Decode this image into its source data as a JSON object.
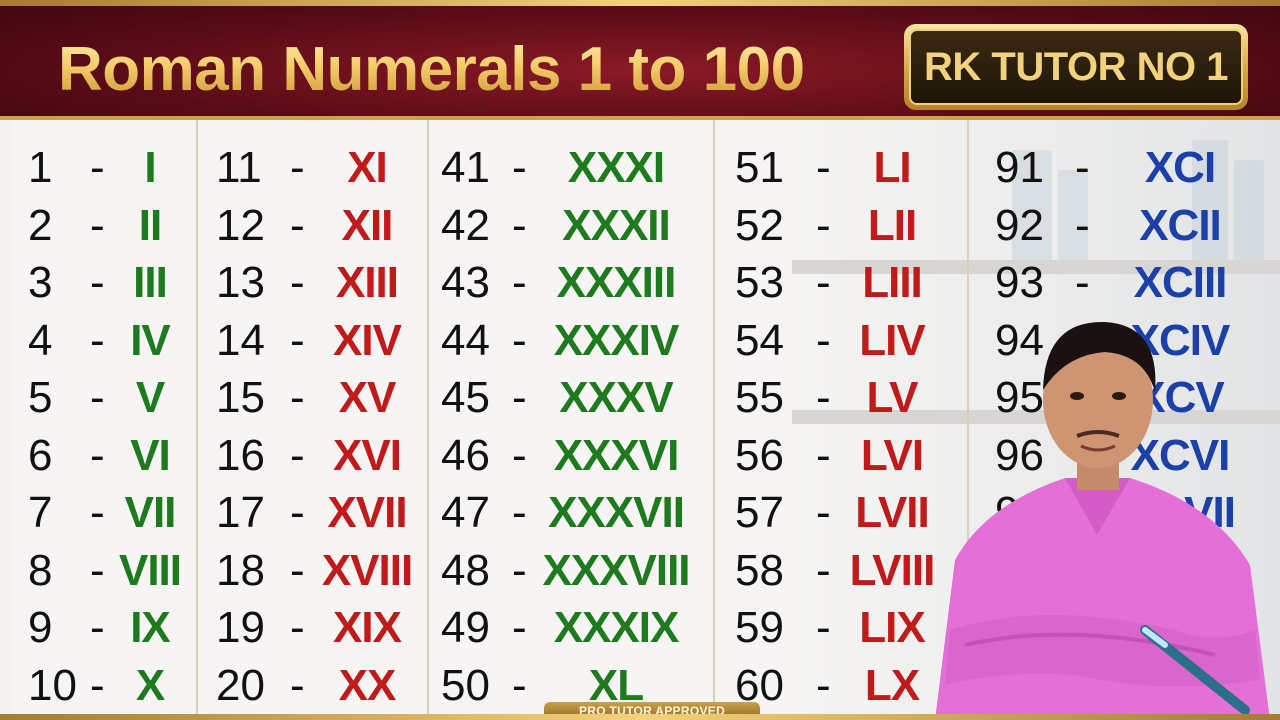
{
  "header": {
    "title": "Roman Numerals 1 to 100",
    "badge": "RK TUTOR NO 1"
  },
  "footer": {
    "badge": "PRO TUTOR APPROVED"
  },
  "columns": [
    {
      "color": "green",
      "rows": [
        {
          "n": "1",
          "r": "I"
        },
        {
          "n": "2",
          "r": "II"
        },
        {
          "n": "3",
          "r": "III"
        },
        {
          "n": "4",
          "r": "IV"
        },
        {
          "n": "5",
          "r": "V"
        },
        {
          "n": "6",
          "r": "VI"
        },
        {
          "n": "7",
          "r": "VII"
        },
        {
          "n": "8",
          "r": "VIII"
        },
        {
          "n": "9",
          "r": "IX"
        },
        {
          "n": "10",
          "r": "X"
        }
      ]
    },
    {
      "color": "red",
      "rows": [
        {
          "n": "11",
          "r": "XI"
        },
        {
          "n": "12",
          "r": "XII"
        },
        {
          "n": "13",
          "r": "XIII"
        },
        {
          "n": "14",
          "r": "XIV"
        },
        {
          "n": "15",
          "r": "XV"
        },
        {
          "n": "16",
          "r": "XVI"
        },
        {
          "n": "17",
          "r": "XVII"
        },
        {
          "n": "18",
          "r": "XVIII"
        },
        {
          "n": "19",
          "r": "XIX"
        },
        {
          "n": "20",
          "r": "XX"
        }
      ]
    },
    {
      "color": "green",
      "rows": [
        {
          "n": "41",
          "r": "XXXI"
        },
        {
          "n": "42",
          "r": "XXXII"
        },
        {
          "n": "43",
          "r": "XXXIII"
        },
        {
          "n": "44",
          "r": "XXXIV"
        },
        {
          "n": "45",
          "r": "XXXV"
        },
        {
          "n": "46",
          "r": "XXXVI"
        },
        {
          "n": "47",
          "r": "XXXVII"
        },
        {
          "n": "48",
          "r": "XXXVIII"
        },
        {
          "n": "49",
          "r": "XXXIX"
        },
        {
          "n": "50",
          "r": "XL"
        }
      ]
    },
    {
      "color": "red",
      "rows": [
        {
          "n": "51",
          "r": "LI"
        },
        {
          "n": "52",
          "r": "LII"
        },
        {
          "n": "53",
          "r": "LIII"
        },
        {
          "n": "54",
          "r": "LIV"
        },
        {
          "n": "55",
          "r": "LV"
        },
        {
          "n": "56",
          "r": "LVI"
        },
        {
          "n": "57",
          "r": "LVII"
        },
        {
          "n": "58",
          "r": "LVIII"
        },
        {
          "n": "59",
          "r": "LIX"
        },
        {
          "n": "60",
          "r": "LX"
        }
      ]
    },
    {
      "color": "blue",
      "rows": [
        {
          "n": "91",
          "r": "XCI"
        },
        {
          "n": "92",
          "r": "XCII"
        },
        {
          "n": "93",
          "r": "XCIII"
        },
        {
          "n": "94",
          "r": "XCIV"
        },
        {
          "n": "95",
          "r": "XCV"
        },
        {
          "n": "96",
          "r": "XCVI"
        },
        {
          "n": "97",
          "r": "XCVII"
        }
      ]
    }
  ],
  "dash": "-",
  "colors": {
    "green": "#1e7a1e",
    "red": "#c01a1a",
    "blue": "#1c3fa8",
    "banner": "#5d0d17",
    "gold": "#f2c965"
  }
}
